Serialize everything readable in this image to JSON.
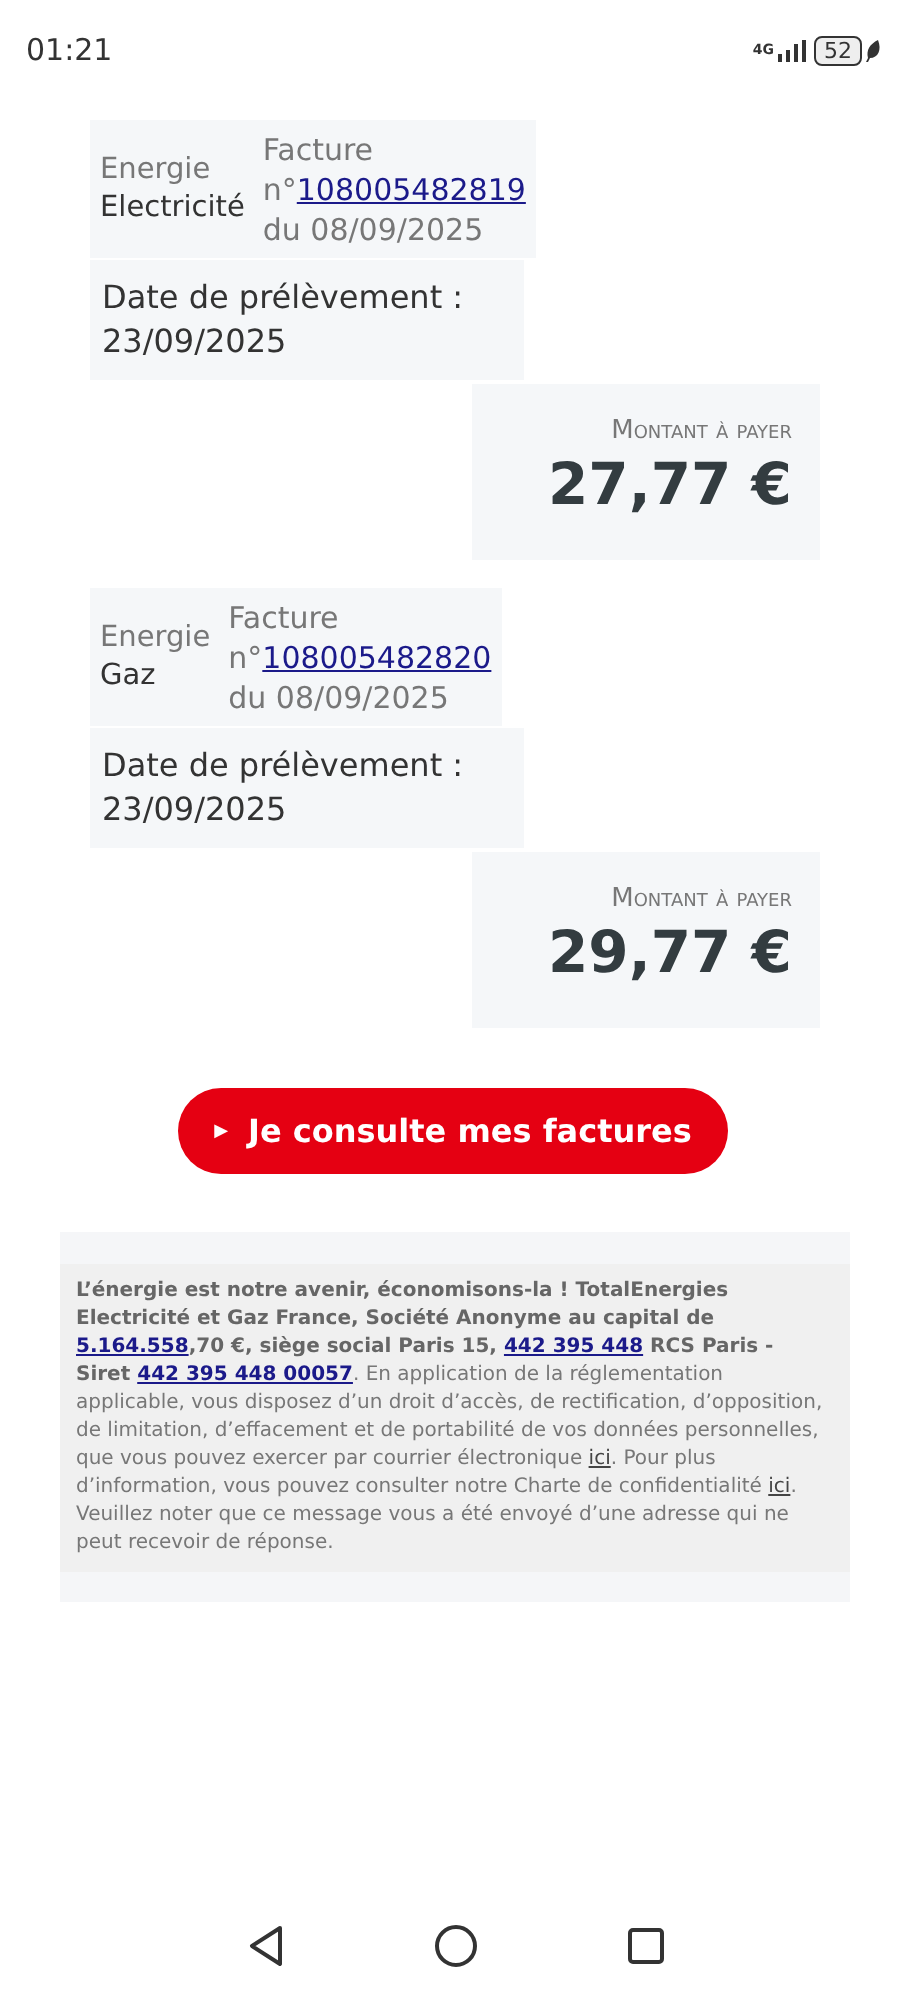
{
  "status_bar": {
    "time": "01:21",
    "network": "4G",
    "battery": "52"
  },
  "bills": [
    {
      "energy_label": "Energie",
      "energy": "Electricité",
      "invoice_label": "Facture",
      "invoice_prefix": "n°",
      "invoice_number": "108005482819",
      "invoice_date": "du 08/09/2025",
      "debit_label": "Date de prélèvement :",
      "debit_date": "23/09/2025",
      "amount_label": "Montant à payer",
      "amount": "27,77 €"
    },
    {
      "energy_label": "Energie",
      "energy": "Gaz",
      "invoice_label": "Facture",
      "invoice_prefix": "n°",
      "invoice_number": "108005482820",
      "invoice_date": "du 08/09/2025",
      "debit_label": "Date de prélèvement :",
      "debit_date": "23/09/2025",
      "amount_label": "Montant à payer",
      "amount": "29,77 €"
    }
  ],
  "cta_button": {
    "icon": "▶",
    "label": "Je consulte mes factures"
  },
  "legal_notice": [
    {
      "kind": "bold",
      "text": "L’énergie est notre avenir, économisons-la ! TotalEnergies Electricité et Gaz France, Société Anonyme au capital de "
    },
    {
      "kind": "bold_link",
      "text": "5.164.558"
    },
    {
      "kind": "bold",
      "text": ",70 €, siège social Paris 15, "
    },
    {
      "kind": "bold_link",
      "text": "442 395 448"
    },
    {
      "kind": "bold",
      "text": " RCS Paris - Siret "
    },
    {
      "kind": "bold_link",
      "text": "442 395 448 00057"
    },
    {
      "kind": "text",
      "text": ". En application de la réglementation applicable, vous disposez d’un droit d’accès, de rectification, d’opposition, de limitation, d’effacement et de portabilité de vos données personnelles, que vous pouvez exercer par courrier électronique "
    },
    {
      "kind": "link",
      "text": "ici"
    },
    {
      "kind": "text",
      "text": ". Pour plus d’information, vous pouvez consulter notre Charte de confidentialité "
    },
    {
      "kind": "link",
      "text": "ici"
    },
    {
      "kind": "text",
      "text": ". Veuillez noter que ce message vous a été envoyé d’une adresse qui ne peut recevoir de réponse."
    }
  ]
}
